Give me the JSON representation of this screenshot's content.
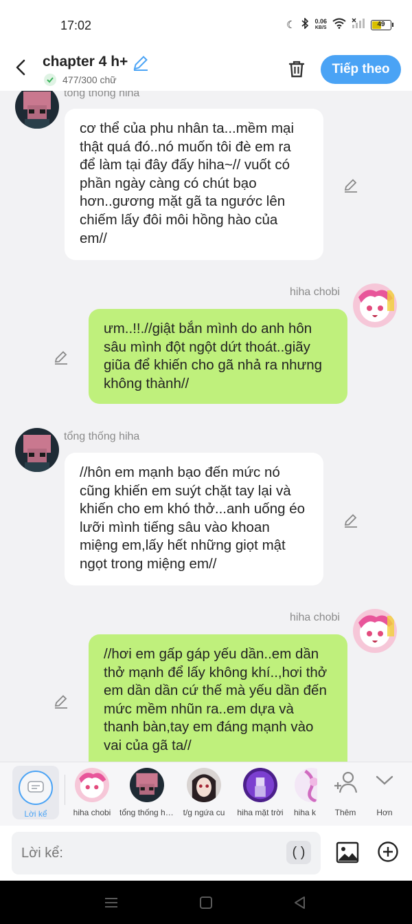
{
  "status": {
    "time": "17:02",
    "net_speed": "0.06",
    "net_unit": "KB/S",
    "battery": "49"
  },
  "header": {
    "title": "chapter 4 h+",
    "char_count": "477/300 chữ",
    "next_label": "Tiếp theo"
  },
  "messages": [
    {
      "side": "left",
      "sender": "tổng thống hiha",
      "text": "cơ thể của phu nhân ta...mềm mại thật quá đó..nó muốn tôi đè em ra để làm tại đây đấy hiha~// vuốt có phần ngày càng có chút bạo hơn..gương mặt gã ta ngước lên chiếm lấy đôi môi hồng hào của em//"
    },
    {
      "side": "right",
      "sender": "hiha chobi",
      "text": "ưm..!!.//giật bắn mình do anh hôn sâu mình đột ngột dứt thoát..giãy giũa để khiến cho gã nhả ra nhưng không thành//"
    },
    {
      "side": "left",
      "sender": "tổng thống hiha",
      "text": "//hôn em mạnh bạo đến mức nó cũng khiến em suýt chặt tay lại và khiến cho em khó thở...anh uống éo lưỡi mình tiếng sâu vào khoan miệng em,lấy hết những giọt mật ngọt trong miệng em//"
    },
    {
      "side": "right",
      "sender": "hiha chobi",
      "text": "//hơi em gấp gáp yếu dần..em dần thở mạnh để lấy không khí..,hơi thở em dần dần cứ thế mà yếu dần đến mức mềm nhũn ra..em dựa và thanh bàn,tay em đáng mạnh vào vai của gã ta//"
    }
  ],
  "characters": {
    "narrator": "Lời kể",
    "items": [
      "hiha chobi",
      "tổng thống hiha",
      "t/g ngứa cu",
      "hiha mặt trời",
      "hiha k"
    ],
    "add_label": "Thêm",
    "more_label": "Hơn"
  },
  "input": {
    "placeholder": "Lời kể:",
    "paren": "( )"
  },
  "colors": {
    "accent": "#4aa3f5",
    "bubble_right": "#bff07c",
    "bubble_left": "#ffffff"
  }
}
